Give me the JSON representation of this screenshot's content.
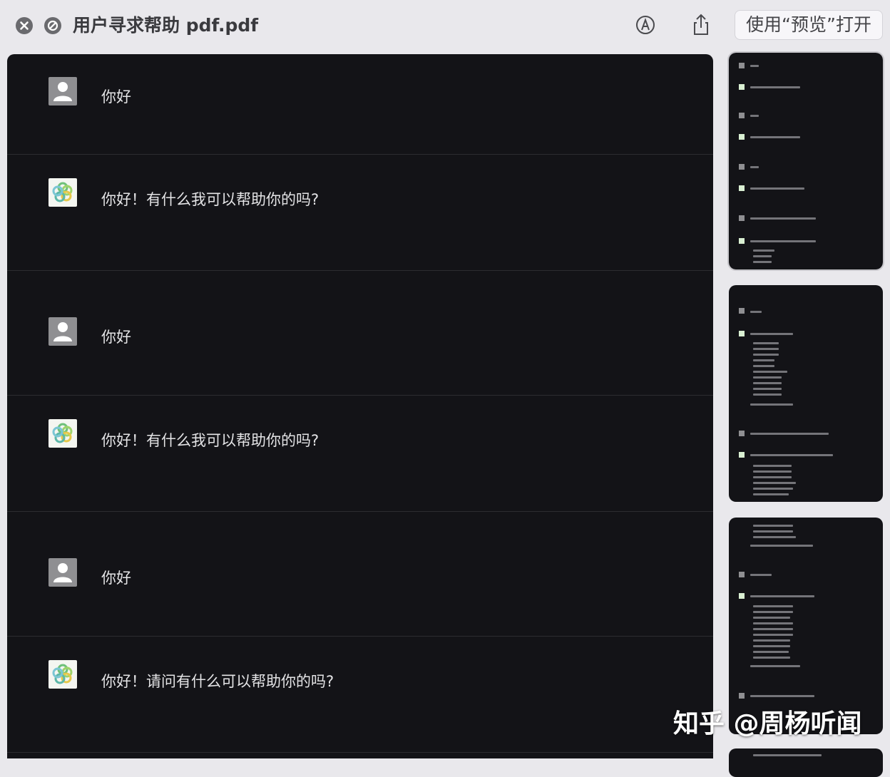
{
  "window": {
    "title": "用户寻求帮助 pdf.pdf",
    "open_button_label": "使用“预览”打开"
  },
  "icons": {
    "close": "close-icon",
    "hide": "hide-icon",
    "markup": "markup-icon",
    "share": "share-icon",
    "user_avatar": "user-avatar-icon",
    "bot_avatar": "chatgpt-logo-icon"
  },
  "messages": [
    {
      "role": "user",
      "text": "你好"
    },
    {
      "role": "assistant",
      "text": "你好！有什么我可以帮助你的吗?"
    },
    {
      "role": "user",
      "text": "你好"
    },
    {
      "role": "assistant",
      "text": "你好！有什么我可以帮助你的吗?"
    },
    {
      "role": "user",
      "text": "你好"
    },
    {
      "role": "assistant",
      "text": "你好！请问有什么可以帮助你的吗?"
    }
  ],
  "thumbnails": [
    {
      "page": 1,
      "selected": true
    },
    {
      "page": 2,
      "selected": false
    },
    {
      "page": 3,
      "selected": false
    },
    {
      "page": 4,
      "selected": false
    }
  ],
  "watermark": "知乎 @周杨听闻",
  "colors": {
    "titlebar_bg": "#e9e8ec",
    "document_bg": "#131317",
    "text": "#e4e4e6"
  }
}
